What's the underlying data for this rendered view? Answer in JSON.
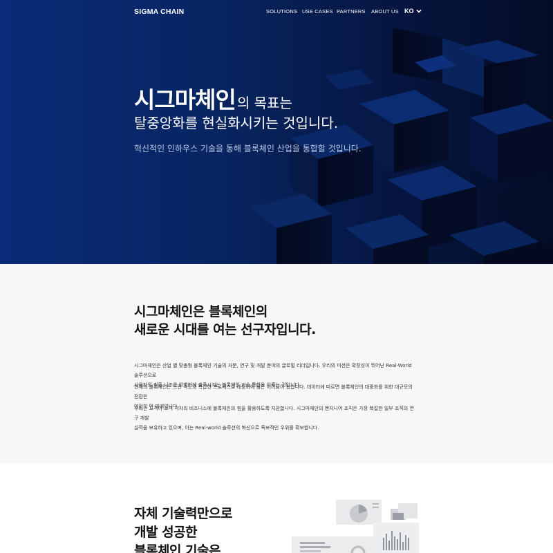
{
  "nav": {
    "logo": "SIGMA CHAIN",
    "items": [
      "SOLUTIONS",
      "USE CASES",
      "PARTNERS",
      "ABOUT US"
    ],
    "lang": "KO"
  },
  "hero": {
    "title_strong": "시그마체인",
    "title_rest": "의 목표는",
    "title_line2": "탈중앙화를 현실화시키는 것입니다.",
    "subtitle": "혁신적인 인하우스 기술을 통해 블록체인 산업을 통합할 것입니다."
  },
  "about": {
    "title_line1": "시그마체인은 블록체인의",
    "title_line2": "새로운 시대를 여는 선구자입니다.",
    "paragraphs": [
      [
        "시그마체인은 산업 별 맞춤형 블록체인 기술의 자문, 연구 및 개발 분야의 글로벌 리더입니다. 우리의 미션은 확장성이 뛰어난 Real-World 솔루션으로",
        "사용자의 최종 니즈를 완벽하게 충족시키는 블록체인 기술 통합을 이루는 것입니다."
      ],
      [
        "현재의 블록체인은 느린 속도와 복잡한 프로세스로 대중화에 많은 어려움이 있습니다. 데이터에 따르면 블록체인의 대중화를 위한 대규모의 전환은",
        "여전히 먼 미래입니다."
      ],
      [
        "우리는 고객이 고객 각자의 비즈니스에 블록체인의 힘을 활용하도록 지원합니다. 시그마체인의 엔지니어 조직은 가장 복잡한 일부 조직의 연구 개발",
        "실적을 보유하고 있으며, 이는 Real-world 솔루션의 혁신으로 독보적인 우위를 확보합니다."
      ]
    ]
  },
  "tech": {
    "title_lines": [
      "자체 기술력만으로",
      "개발 성공한",
      "블록체인 기술은"
    ]
  },
  "colors": {
    "hero_start": "#0a2b78",
    "hero_end": "#040d26",
    "about_bg": "#f7f7f7"
  }
}
